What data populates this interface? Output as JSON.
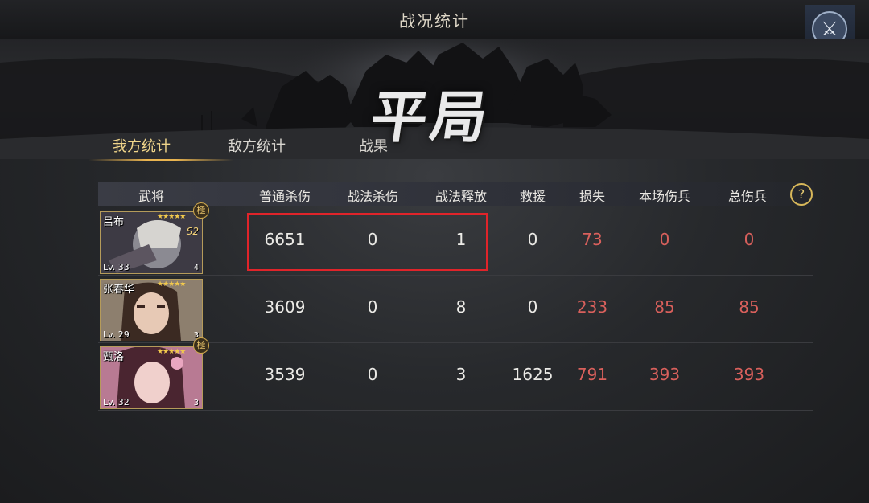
{
  "window": {
    "title": "战况统计"
  },
  "result": {
    "label": "平局"
  },
  "tabs": [
    {
      "label": "我方统计",
      "active": true
    },
    {
      "label": "敌方统计",
      "active": false
    },
    {
      "label": "战果",
      "active": false
    }
  ],
  "table": {
    "headers": [
      "武将",
      "普通杀伤",
      "战法杀伤",
      "战法释放",
      "救援",
      "损失",
      "本场伤兵",
      "总伤兵"
    ],
    "help_label": "?",
    "rows": [
      {
        "name": "吕布",
        "stars": "★★★★★",
        "level": "Lv. 33",
        "rank": "S2",
        "corner": "4",
        "badge": "極",
        "values": [
          "6651",
          "0",
          "1",
          "0",
          "73",
          "0",
          "0"
        ]
      },
      {
        "name": "张春华",
        "stars": "★★★★★",
        "level": "Lv. 29",
        "rank": "",
        "corner": "3",
        "badge": "",
        "values": [
          "3609",
          "0",
          "8",
          "0",
          "233",
          "85",
          "85"
        ]
      },
      {
        "name": "甄洛",
        "stars": "★★★★★",
        "level": "Lv. 32",
        "rank": "",
        "corner": "3",
        "badge": "極",
        "values": [
          "3539",
          "0",
          "3",
          "1625",
          "791",
          "393",
          "393"
        ]
      }
    ]
  },
  "colors": {
    "accent": "#e9b450",
    "loss_red": "#d9605c",
    "highlight_box": "#e0242a"
  },
  "icons": {
    "close": "crossed-swords-icon",
    "help": "question-icon"
  }
}
